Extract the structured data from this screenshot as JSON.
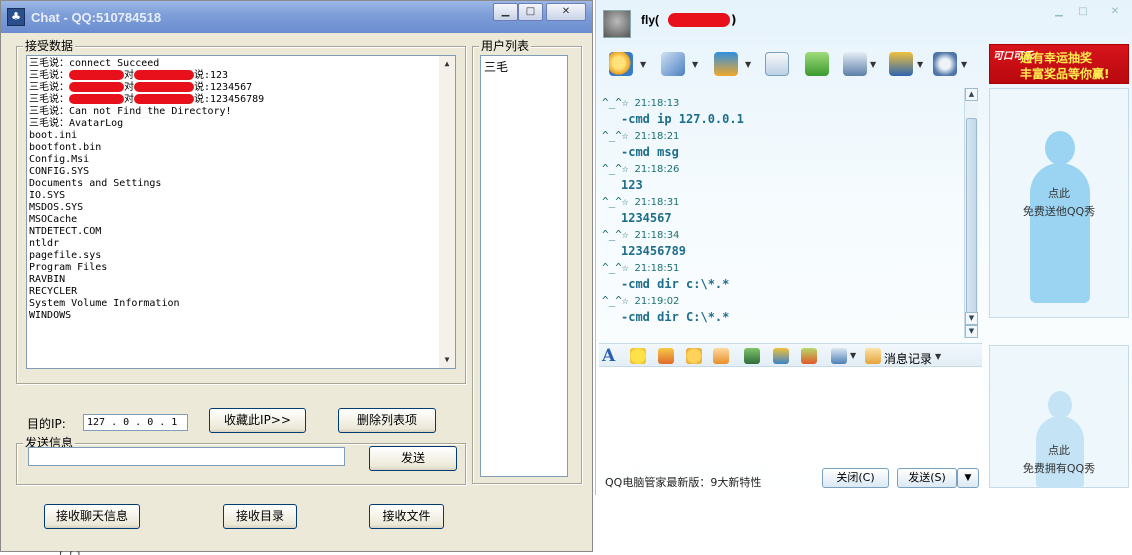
{
  "chat_window": {
    "title": "Chat - QQ:510784518",
    "received_group_label": "接受数据",
    "received_lines": [
      {
        "prefix": "三毛说：",
        "text": "connect Succeed"
      },
      {
        "prefix": "三毛说：",
        "mid": "对",
        "suffix": "说:123"
      },
      {
        "prefix": "三毛说：",
        "mid": "对",
        "suffix": "说:1234567"
      },
      {
        "prefix": "三毛说：",
        "mid": "对",
        "suffix": "说:123456789"
      },
      {
        "prefix": "三毛说：",
        "text": "Can not Find the Directory!"
      },
      {
        "prefix": "三毛说：",
        "text": "AvatarLog"
      },
      {
        "text": "boot.ini"
      },
      {
        "text": "bootfont.bin"
      },
      {
        "text": "Config.Msi"
      },
      {
        "text": "CONFIG.SYS"
      },
      {
        "text": "Documents and Settings"
      },
      {
        "text": "IO.SYS"
      },
      {
        "text": "MSDOS.SYS"
      },
      {
        "text": "MSOCache"
      },
      {
        "text": "NTDETECT.COM"
      },
      {
        "text": "ntldr"
      },
      {
        "text": "pagefile.sys"
      },
      {
        "text": "Program Files"
      },
      {
        "text": "RAVBIN"
      },
      {
        "text": "RECYCLER"
      },
      {
        "text": "System Volume Information"
      },
      {
        "text": "WINDOWS"
      }
    ],
    "user_list_label": "用户列表",
    "users": [
      "三毛"
    ],
    "target_ip_label": "目的IP:",
    "target_ip_value": "127 . 0  . 0  . 1",
    "save_ip_button": "收藏此IP>>",
    "delete_item_button": "删除列表项",
    "send_group_label": "发送信息",
    "send_input_value": "",
    "send_button": "发送",
    "recv_chat_button": "接收聊天信息",
    "recv_dir_button": "接收目录",
    "recv_file_button": "接收文件",
    "bottom_fragment": "— ,  ,  .[ ,[ ]"
  },
  "qq_window": {
    "contact_name": "fly(",
    "contact_name_close": ")",
    "messages": [
      {
        "sender": "^_^☆",
        "time": "21:18:13",
        "body": "-cmd ip 127.0.0.1"
      },
      {
        "sender": "^_^☆",
        "time": "21:18:21",
        "body": "-cmd msg"
      },
      {
        "sender": "^_^☆",
        "time": "21:18:26",
        "body": "123"
      },
      {
        "sender": "^_^☆",
        "time": "21:18:31",
        "body": "1234567"
      },
      {
        "sender": "^_^☆",
        "time": "21:18:34",
        "body": "123456789"
      },
      {
        "sender": "^_^☆",
        "time": "21:18:51",
        "body": "-cmd dir c:\\*.*"
      },
      {
        "sender": "^_^☆",
        "time": "21:19:02",
        "body": "-cmd dir C:\\*.*"
      }
    ],
    "message_history_label": "消息记录",
    "status_text": "QQ电脑管家最新版：9大新特性",
    "close_button": "关闭(C)",
    "send_button": "发送(S)",
    "ad": {
      "brand": "可口可乐",
      "line1": "通有幸运抽奖",
      "line2": "丰富奖品等你赢!"
    },
    "show_top_text_1": "点此",
    "show_top_text_2": "免费送他QQ秀",
    "show_bottom_text_1": "点此",
    "show_bottom_text_2": "免费拥有QQ秀",
    "colors": {
      "accent": "#1d6e8a",
      "redaction": "#e8101a",
      "ad_bg": "#d8141b"
    }
  }
}
